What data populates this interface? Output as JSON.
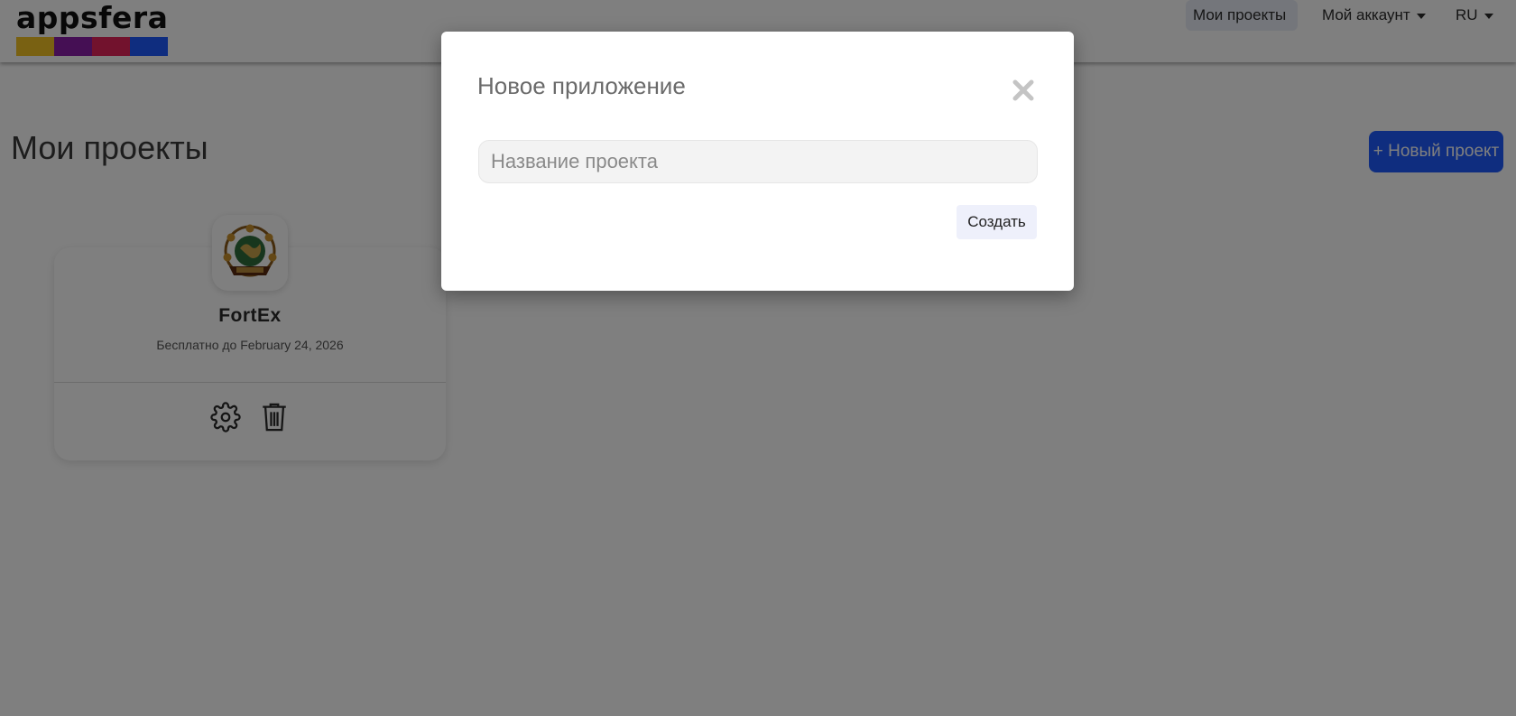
{
  "brand": {
    "name": "appsfera",
    "bar_colors": [
      "#f3c324",
      "#8b1fa8",
      "#e5245a",
      "#1e5bff"
    ]
  },
  "nav": {
    "projects_label": "Мои проекты",
    "account_label": "Мой аккаунт",
    "language_label": "RU"
  },
  "page": {
    "title": "Мои проекты",
    "new_project_label": "+ Новый проект",
    "accent_color": "#1e5bff"
  },
  "projects": [
    {
      "name": "FortEx",
      "subtitle": "Бесплатно до February 24, 2026",
      "icons": [
        "settings-gear-icon",
        "trash-icon"
      ]
    }
  ],
  "modal": {
    "title": "Новое приложение",
    "input_placeholder": "Название проекта",
    "input_value": "",
    "create_label": "Создать",
    "close_icon": "close-icon"
  }
}
